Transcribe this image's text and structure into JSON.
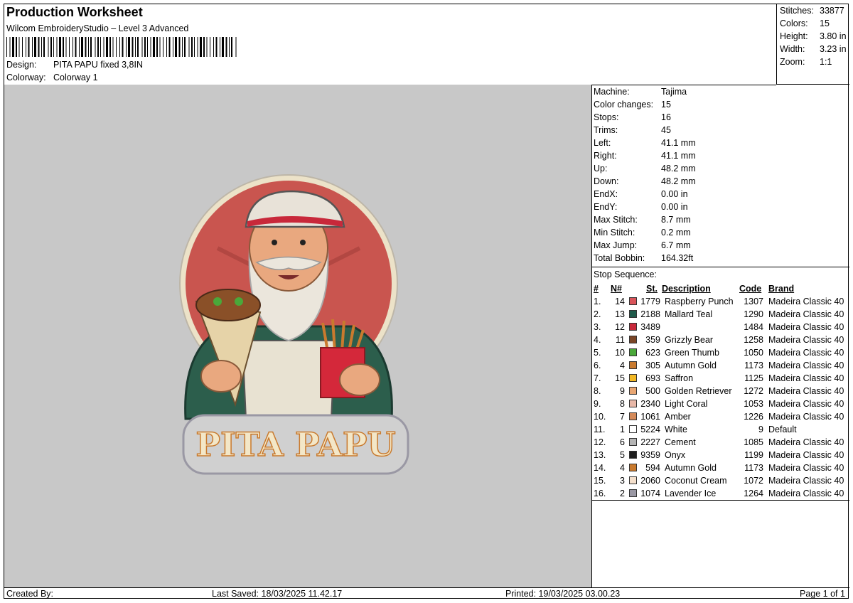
{
  "header": {
    "title": "Production Worksheet",
    "software": "Wilcom EmbroideryStudio – Level 3 Advanced",
    "design_label": "Design:",
    "design_value": "PITA PAPU fixed 3,8IN",
    "colorway_label": "Colorway:",
    "colorway_value": "Colorway 1"
  },
  "summary": [
    {
      "label": "Stitches:",
      "value": "33877"
    },
    {
      "label": "Colors:",
      "value": "15"
    },
    {
      "label": "Height:",
      "value": "3.80 in"
    },
    {
      "label": "Width:",
      "value": "3.23 in"
    },
    {
      "label": "Zoom:",
      "value": "1:1"
    }
  ],
  "preview": {
    "logo_text": "PITA PAPU"
  },
  "machine_info": [
    {
      "label": "Machine:",
      "value": "Tajima"
    },
    {
      "label": "Color changes:",
      "value": "15"
    },
    {
      "label": "Stops:",
      "value": "16"
    },
    {
      "label": "Trims:",
      "value": "45"
    },
    {
      "label": "Left:",
      "value": "41.1 mm"
    },
    {
      "label": "Right:",
      "value": "41.1 mm"
    },
    {
      "label": "Up:",
      "value": "48.2 mm"
    },
    {
      "label": "Down:",
      "value": "48.2 mm"
    },
    {
      "label": "EndX:",
      "value": "0.00 in"
    },
    {
      "label": "EndY:",
      "value": "0.00 in"
    },
    {
      "label": "Max Stitch:",
      "value": "8.7 mm"
    },
    {
      "label": "Min Stitch:",
      "value": "0.2 mm"
    },
    {
      "label": "Max Jump:",
      "value": "6.7 mm"
    },
    {
      "label": "Total Bobbin:",
      "value": "164.32ft"
    }
  ],
  "stop_sequence": {
    "label": "Stop Sequence:",
    "headers": {
      "num": "#",
      "n": "N#",
      "st": "St.",
      "description": "Description",
      "code": "Code",
      "brand": "Brand"
    },
    "rows": [
      {
        "num": "1.",
        "n": "14",
        "color": "#d9545a",
        "st": "1779",
        "desc": "Raspberry Punch",
        "code": "1307",
        "brand": "Madeira Classic 40"
      },
      {
        "num": "2.",
        "n": "13",
        "color": "#1f5a4a",
        "st": "2188",
        "desc": "Mallard Teal",
        "code": "1290",
        "brand": "Madeira Classic 40"
      },
      {
        "num": "3.",
        "n": "12",
        "color": "#c8283a",
        "st": "3489",
        "desc": "",
        "code": "1484",
        "brand": "Madeira Classic 40"
      },
      {
        "num": "4.",
        "n": "11",
        "color": "#7a4526",
        "st": "359",
        "desc": "Grizzly Bear",
        "code": "1258",
        "brand": "Madeira Classic 40"
      },
      {
        "num": "5.",
        "n": "10",
        "color": "#4aa83a",
        "st": "623",
        "desc": "Green Thumb",
        "code": "1050",
        "brand": "Madeira Classic 40"
      },
      {
        "num": "6.",
        "n": "4",
        "color": "#c97a2e",
        "st": "305",
        "desc": "Autumn Gold",
        "code": "1173",
        "brand": "Madeira Classic 40"
      },
      {
        "num": "7.",
        "n": "15",
        "color": "#f2b824",
        "st": "693",
        "desc": "Saffron",
        "code": "1125",
        "brand": "Madeira Classic 40"
      },
      {
        "num": "8.",
        "n": "9",
        "color": "#e8a673",
        "st": "500",
        "desc": "Golden Retriever",
        "code": "1272",
        "brand": "Madeira Classic 40"
      },
      {
        "num": "9.",
        "n": "8",
        "color": "#e8b8a8",
        "st": "2340",
        "desc": "Light Coral",
        "code": "1053",
        "brand": "Madeira Classic 40"
      },
      {
        "num": "10.",
        "n": "7",
        "color": "#d48a5a",
        "st": "1061",
        "desc": "Amber",
        "code": "1226",
        "brand": "Madeira Classic 40"
      },
      {
        "num": "11.",
        "n": "1",
        "color": "#ffffff",
        "st": "5224",
        "desc": "White",
        "code": "9",
        "brand": "Default"
      },
      {
        "num": "12.",
        "n": "6",
        "color": "#b5b5b5",
        "st": "2227",
        "desc": "Cement",
        "code": "1085",
        "brand": "Madeira Classic 40"
      },
      {
        "num": "13.",
        "n": "5",
        "color": "#1e1e1e",
        "st": "9359",
        "desc": "Onyx",
        "code": "1199",
        "brand": "Madeira Classic 40"
      },
      {
        "num": "14.",
        "n": "4",
        "color": "#c97a2e",
        "st": "594",
        "desc": "Autumn Gold",
        "code": "1173",
        "brand": "Madeira Classic 40"
      },
      {
        "num": "15.",
        "n": "3",
        "color": "#f5e0cc",
        "st": "2060",
        "desc": "Coconut Cream",
        "code": "1072",
        "brand": "Madeira Classic 40"
      },
      {
        "num": "16.",
        "n": "2",
        "color": "#9a98a4",
        "st": "1074",
        "desc": "Lavender Ice",
        "code": "1264",
        "brand": "Madeira Classic 40"
      }
    ]
  },
  "footer": {
    "created_by": "Created By:",
    "last_saved": "Last Saved: 18/03/2025 11.42.17",
    "printed": "Printed: 19/03/2025 03.00.23",
    "page": "Page 1 of 1"
  }
}
